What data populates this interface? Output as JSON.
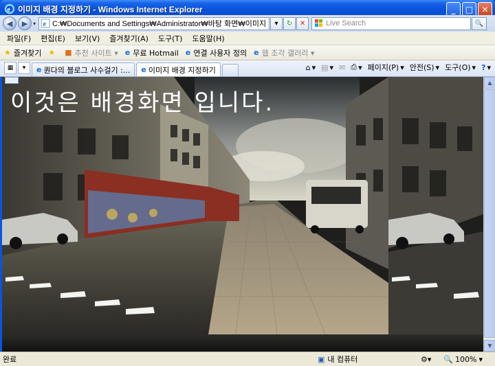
{
  "window": {
    "title": "이미지 배경 지정하기 - Windows Internet Explorer",
    "controls": [
      "minimize",
      "maximize",
      "close"
    ]
  },
  "address": {
    "url": "C:₩Documents and Settings₩Administrator₩바탕 화면₩이미지 배경 지",
    "search_placeholder": "Live Search"
  },
  "menu": {
    "items": [
      "파일(F)",
      "편집(E)",
      "보기(V)",
      "즐겨찾기(A)",
      "도구(T)",
      "도움말(H)"
    ]
  },
  "favorites": {
    "label": "즐겨찾기",
    "items": [
      {
        "label": "추천 사이트 ▾",
        "dim": true
      },
      {
        "label": "무료 Hotmail",
        "dim": false
      },
      {
        "label": "연결 사용자 정의",
        "dim": false
      },
      {
        "label": "웹 조각 갤러리 ▾",
        "dim": true
      }
    ]
  },
  "tabs": {
    "items": [
      {
        "label": "퀀다의 블로그 사수걸기 :...",
        "active": false
      },
      {
        "label": "이미지 배경 지정하기",
        "active": true
      }
    ]
  },
  "command_bar": {
    "page": "페이지(P)",
    "safety": "안전(S)",
    "tools": "도구(O)"
  },
  "content": {
    "heading": "이것은 배경화면 입니다."
  },
  "status": {
    "text": "완료",
    "zone": "내 컴퓨터",
    "zoom": "100%"
  },
  "colors": {
    "titlebar": "#0854dc",
    "chrome": "#ece9d8",
    "accent": "#3a6fd8"
  }
}
